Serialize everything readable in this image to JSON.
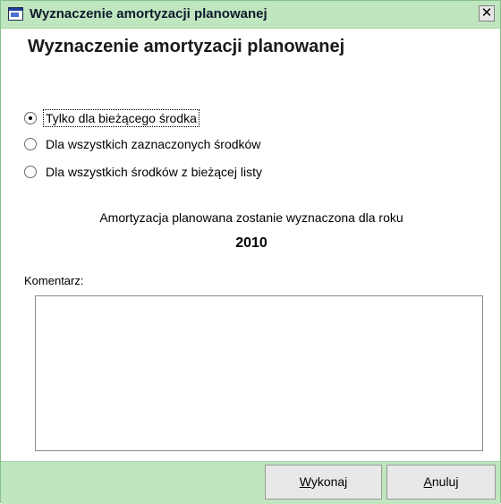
{
  "window": {
    "title": "Wyznaczenie amortyzacji planowanej",
    "close_glyph": "✕"
  },
  "heading": "Wyznaczenie amortyzacji planowanej",
  "options": [
    {
      "label": "Tylko dla bieżącego środka",
      "checked": true
    },
    {
      "label": "Dla wszystkich zaznaczonych środków",
      "checked": false
    },
    {
      "label": "Dla wszystkich środków z bieżącej listy",
      "checked": false
    }
  ],
  "info": {
    "text": "Amortyzacja planowana zostanie wyznaczona dla roku",
    "year": "2010"
  },
  "comment": {
    "label": "Komentarz:",
    "value": ""
  },
  "buttons": {
    "execute": {
      "mnemonic": "W",
      "rest": "ykonaj"
    },
    "cancel": {
      "mnemonic": "A",
      "rest": "nuluj"
    }
  },
  "colors": {
    "titlebar": "#bfe6be",
    "footer": "#bfe6be",
    "button": "#e8e8e8"
  },
  "icons": {
    "app": "app-window-icon",
    "close": "close-icon"
  }
}
